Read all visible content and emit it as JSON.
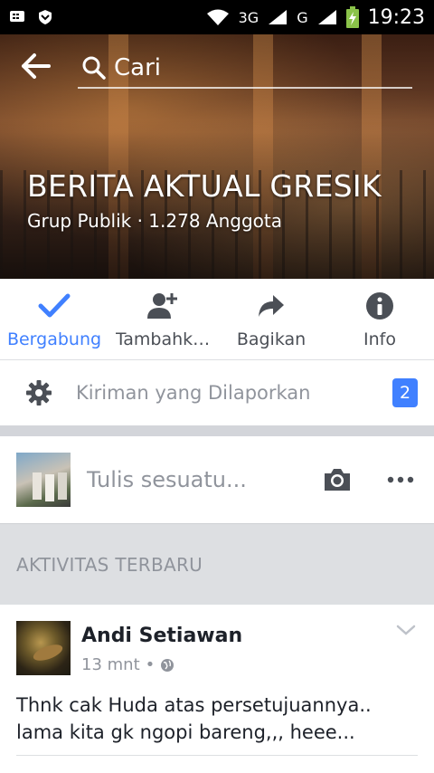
{
  "status_bar": {
    "network_1": "3G",
    "network_2": "G",
    "time": "19:23"
  },
  "header": {
    "search_placeholder": "Cari"
  },
  "group": {
    "title": "BERITA AKTUAL GRESIK",
    "subtitle": "Grup Publik · 1.278 Anggota"
  },
  "actions": [
    {
      "label": "Bergabung",
      "icon": "check-icon",
      "active": true
    },
    {
      "label": "Tambahk…",
      "icon": "add-person-icon",
      "active": false
    },
    {
      "label": "Bagikan",
      "icon": "share-arrow-icon",
      "active": false
    },
    {
      "label": "Info",
      "icon": "info-icon",
      "active": false
    }
  ],
  "reported": {
    "label": "Kiriman yang Dilaporkan",
    "count": "2"
  },
  "composer": {
    "placeholder": "Tulis sesuatu..."
  },
  "section": {
    "title": "AKTIVITAS TERBARU"
  },
  "post": {
    "author": "Andi Setiawan",
    "time": "13 mnt",
    "separator": "•",
    "text": "Thnk cak Huda atas persetujuannya.. lama kita gk ngopi bareng,,, heee..."
  },
  "colors": {
    "accent": "#4080ff",
    "secondary_text": "#90949c",
    "divider": "#dddfe2"
  }
}
